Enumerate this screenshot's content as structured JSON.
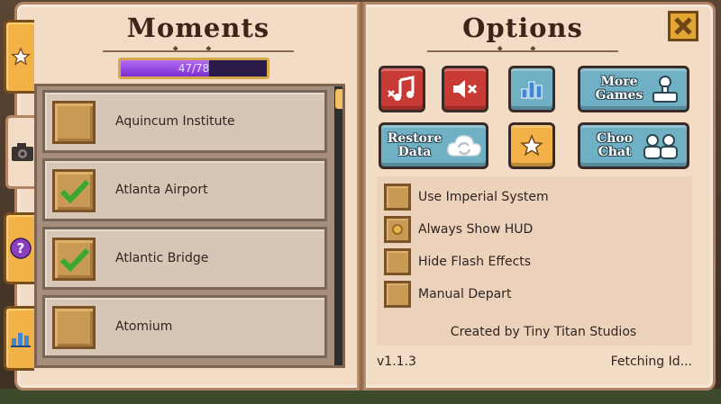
{
  "moments": {
    "title": "Moments",
    "progress_text": "47/78",
    "progress_fraction": 0.6026,
    "items": [
      {
        "label": "Aquincum Institute",
        "checked": false
      },
      {
        "label": "Atlanta Airport",
        "checked": true
      },
      {
        "label": "Atlantic Bridge",
        "checked": true
      },
      {
        "label": "Atomium",
        "checked": false
      }
    ]
  },
  "tabs": [
    {
      "icon": "star-icon",
      "active": false
    },
    {
      "icon": "camera-icon",
      "active": true
    },
    {
      "icon": "question-icon",
      "active": false
    },
    {
      "icon": "bar-chart-icon",
      "active": false
    }
  ],
  "options": {
    "title": "Options",
    "buttons": {
      "more_games_label": "More Games",
      "restore_data_label": "Restore Data",
      "choo_chat_label": "Choo Chat"
    },
    "settings": [
      {
        "label": "Use Imperial System",
        "checked": false
      },
      {
        "label": "Always Show HUD",
        "checked": true
      },
      {
        "label": "Hide Flash Effects",
        "checked": false
      },
      {
        "label": "Manual Depart",
        "checked": false
      }
    ],
    "credits": "Created by Tiny Titan Studios",
    "version": "v1.1.3",
    "status": "Fetching Id..."
  },
  "colors": {
    "page": "#f3dcc6",
    "accent_red": "#c83a36",
    "accent_blue": "#6fb0c4",
    "accent_gold": "#f2b247",
    "progress": "#7a2ed1",
    "check_green": "#3aa830"
  }
}
